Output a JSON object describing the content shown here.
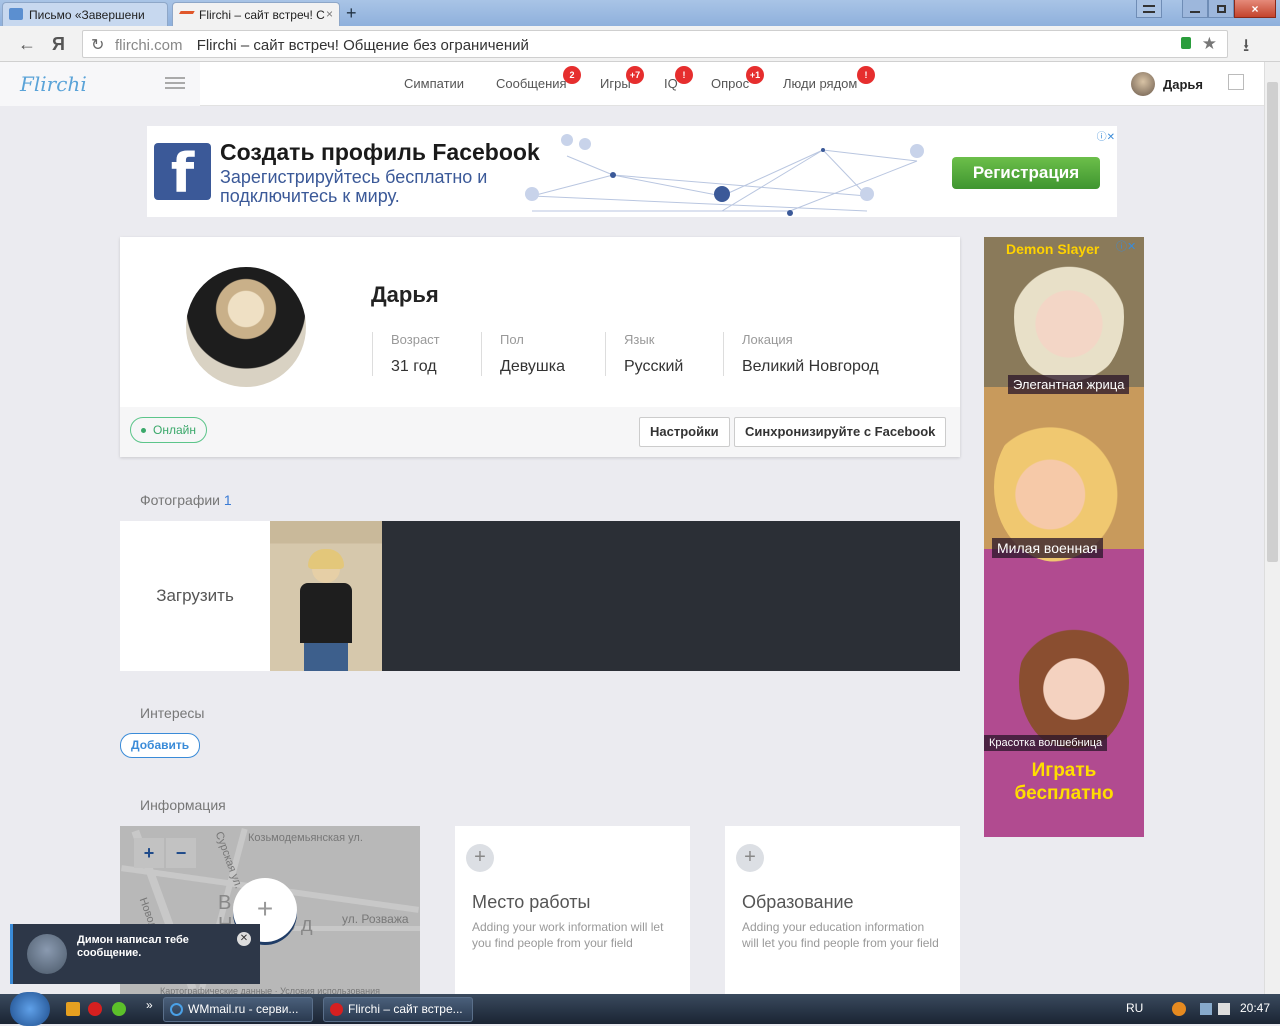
{
  "browser": {
    "tabs": [
      {
        "title": "Письмо «Завершени"
      },
      {
        "title": "Flirchi – сайт встреч! С"
      }
    ],
    "url_domain": "flirchi.com",
    "url_title": "Flirchi – сайт встреч! Общение без ограничений",
    "back_glyph": "←",
    "yandex_glyph": "Я",
    "reload_glyph": "↻",
    "star_glyph": "★",
    "download_glyph": "⭳",
    "newtab_glyph": "+",
    "close_glyph": "×"
  },
  "header": {
    "logo": "Flirchi",
    "menu": [
      {
        "label": "Симпатии",
        "badge": ""
      },
      {
        "label": "Сообщения",
        "badge": "2"
      },
      {
        "label": "Игры",
        "badge": "+7"
      },
      {
        "label": "IQ",
        "badge": "!"
      },
      {
        "label": "Опрос",
        "badge": "+1"
      },
      {
        "label": "Люди рядом",
        "badge": "!"
      }
    ],
    "user_name": "Дарья"
  },
  "ad_banner": {
    "logo_letter": "f",
    "title": "Создать профиль Facebook",
    "subtitle": "Зарегистрируйтесь бесплатно и подключитесь к миру.",
    "button": "Регистрация",
    "info_glyph": "ⓘ✕"
  },
  "profile": {
    "name": "Дарья",
    "fields": [
      {
        "label": "Возраст",
        "value": "31 год"
      },
      {
        "label": "Пол",
        "value": "Девушка"
      },
      {
        "label": "Язык",
        "value": "Русский"
      },
      {
        "label": "Локация",
        "value": "Великий Новгород"
      }
    ],
    "status": "Онлайн",
    "settings_button": "Настройки",
    "facebook_button": "Синхронизируйте с Facebook"
  },
  "photos": {
    "heading": "Фотографии",
    "count": "1",
    "upload_label": "Загрузить"
  },
  "interests": {
    "heading": "Интересы",
    "add_button": "Добавить"
  },
  "info": {
    "heading": "Информация",
    "map": {
      "zoom_in": "+",
      "zoom_out": "−",
      "street1": "Козьмодемьянская ул.",
      "street2": "ул. Розважа",
      "street3": "Новолучанская",
      "street4": "Сурская ул.",
      "city_letters": "В       й",
      "city_letters2": "Н    г о р о д",
      "add_glyph": "+",
      "footer": "Картографические данные · Условия использования"
    },
    "work": {
      "plus": "+",
      "title": "Место работы",
      "desc": "Adding your work information will let you find people from your field"
    },
    "education": {
      "plus": "+",
      "title": "Образование",
      "desc": "Adding your education information will let you find people from your field"
    }
  },
  "side_ad": {
    "title": "Demon Slayer",
    "label1": "Элегантная жрица",
    "label2": "Милая военная",
    "label3": "Красотка волшебница",
    "play": "Играть бесплатно",
    "info_glyph": "ⓘ✕"
  },
  "notification": {
    "text": "Димон написал тебе сообщение.",
    "close": "✕"
  },
  "taskbar": {
    "items": [
      {
        "label": "WMmail.ru - серви..."
      },
      {
        "label": "Flirchi – сайт встре..."
      }
    ],
    "lang": "RU",
    "time": "20:47",
    "more_glyph": "»"
  }
}
